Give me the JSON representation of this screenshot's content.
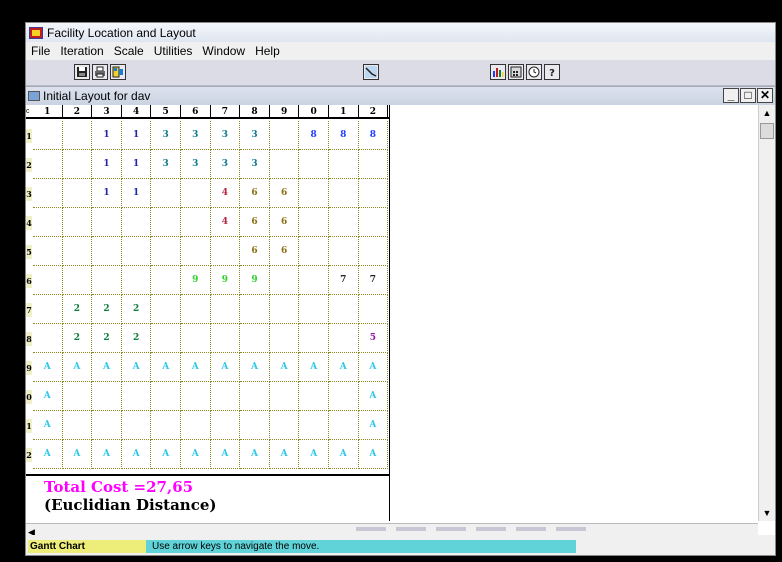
{
  "app": {
    "title": "Facility Location and Layout"
  },
  "menu": [
    "File",
    "Iteration",
    "Scale",
    "Utilities",
    "Window",
    "Help"
  ],
  "child": {
    "title": "Initial Layout for dav"
  },
  "grid": {
    "col_headers": [
      "1",
      "2",
      "3",
      "4",
      "5",
      "6",
      "7",
      "8",
      "9",
      "0",
      "1",
      "2"
    ],
    "row_labels": [
      "1",
      "2",
      "3",
      "4",
      "5",
      "6",
      "7",
      "8",
      "9",
      "0",
      "1",
      "2"
    ],
    "cells": [
      [
        "",
        "",
        "1",
        "1",
        "3",
        "3",
        "3",
        "3",
        "",
        "8",
        "8",
        "8"
      ],
      [
        "",
        "",
        "1",
        "1",
        "3",
        "3",
        "3",
        "3",
        "",
        "",
        "",
        ""
      ],
      [
        "",
        "",
        "1",
        "1",
        "",
        "",
        "4",
        "6",
        "6",
        "",
        "",
        ""
      ],
      [
        "",
        "",
        "",
        "",
        "",
        "",
        "4",
        "6",
        "6",
        "",
        "",
        ""
      ],
      [
        "",
        "",
        "",
        "",
        "",
        "",
        "",
        "6",
        "6",
        "",
        "",
        ""
      ],
      [
        "",
        "",
        "",
        "",
        "",
        "9",
        "9",
        "9",
        "",
        "",
        "7",
        "7"
      ],
      [
        "",
        "2",
        "2",
        "2",
        "",
        "",
        "",
        "",
        "",
        "",
        "",
        ""
      ],
      [
        "",
        "2",
        "2",
        "2",
        "",
        "",
        "",
        "",
        "",
        "",
        "",
        "5"
      ],
      [
        "A",
        "A",
        "A",
        "A",
        "A",
        "A",
        "A",
        "A",
        "A",
        "A",
        "A",
        "A"
      ],
      [
        "A",
        "",
        "",
        "",
        "",
        "",
        "",
        "",
        "",
        "",
        "",
        "A"
      ],
      [
        "A",
        "",
        "",
        "",
        "",
        "",
        "",
        "",
        "",
        "",
        "",
        "A"
      ],
      [
        "A",
        "A",
        "A",
        "A",
        "A",
        "A",
        "A",
        "A",
        "A",
        "A",
        "A",
        "A"
      ]
    ],
    "dept_colors": {
      "1": "#2424a8",
      "2": "#0c7f3e",
      "3": "#0f7a8f",
      "4": "#b3243f",
      "5": "#8e1aa0",
      "6": "#8a6f12",
      "7": "#202020",
      "8": "#1f3dff",
      "9": "#31d12a",
      "A": "#2fc7e6"
    }
  },
  "result": {
    "total_cost": "Total Cost =27,65",
    "distance": "(Euclidian Distance)"
  },
  "status": {
    "gantt": "Gantt Chart",
    "hint": "Use arrow keys to navigate the move."
  }
}
